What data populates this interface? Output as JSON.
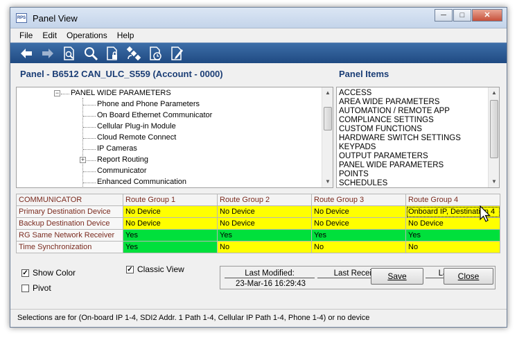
{
  "window": {
    "title": "Panel View",
    "app_icon": "RPS"
  },
  "menu": [
    "File",
    "Edit",
    "Operations",
    "Help"
  ],
  "toolbar": [
    "back-arrow-icon",
    "forward-arrow-icon",
    "document-search-icon",
    "search-icon",
    "locked-document-icon",
    "satellite-icon",
    "document-clock-icon",
    "document-edit-icon"
  ],
  "panel_title": "Panel - B6512 CAN_ULC_S559 (Account - 0000)",
  "items_title": "Panel Items",
  "tree": {
    "root": "PANEL WIDE PARAMETERS",
    "children": [
      "Phone and Phone Parameters",
      "On Board Ethernet Communicator",
      "Cellular Plug-in Module",
      "Cloud Remote Connect",
      "IP Cameras",
      "Report Routing",
      "Communicator",
      "Enhanced Communication"
    ]
  },
  "panel_items": [
    "ACCESS",
    "AREA WIDE PARAMETERS",
    "AUTOMATION / REMOTE APP",
    "COMPLIANCE SETTINGS",
    "CUSTOM FUNCTIONS",
    "HARDWARE SWITCH SETTINGS",
    "KEYPADS",
    "OUTPUT PARAMETERS",
    "PANEL WIDE PARAMETERS",
    "POINTS",
    "SCHEDULES"
  ],
  "grid": {
    "headers": [
      "COMMUNICATOR",
      "Route Group 1",
      "Route Group 2",
      "Route Group 3",
      "Route Group 4"
    ],
    "rows": [
      {
        "label": "Primary Destination Device",
        "cells": [
          "No Device",
          "No Device",
          "No Device",
          "Onboard IP, Destination 4"
        ]
      },
      {
        "label": "Backup Destination Device",
        "cells": [
          "No Device",
          "No Device",
          "No Device",
          "No Device"
        ]
      },
      {
        "label": "RG Same Network Receiver",
        "cells": [
          "Yes",
          "Yes",
          "Yes",
          "Yes"
        ]
      },
      {
        "label": "Time Synchronization",
        "cells": [
          "Yes",
          "No",
          "No",
          "No"
        ]
      }
    ],
    "colors": {
      "yellow": "#ffff00",
      "green": "#00e03c"
    }
  },
  "options": {
    "show_color": {
      "label": "Show Color",
      "checked": true
    },
    "pivot": {
      "label": "Pivot",
      "checked": false
    },
    "classic_view": {
      "label": "Classic View",
      "checked": true
    }
  },
  "status": {
    "last_modified_label": "Last Modified:",
    "last_modified_value": "23-Mar-16 16:29:43",
    "last_received_label": "Last Recei",
    "last_other_label": "La"
  },
  "buttons": {
    "save": "Save",
    "close": "Close"
  },
  "status_bar": "Selections are for (On-board IP 1-4, SDI2 Addr. 1 Path 1-4, Cellular IP Path 1-4, Phone 1-4) or no device"
}
